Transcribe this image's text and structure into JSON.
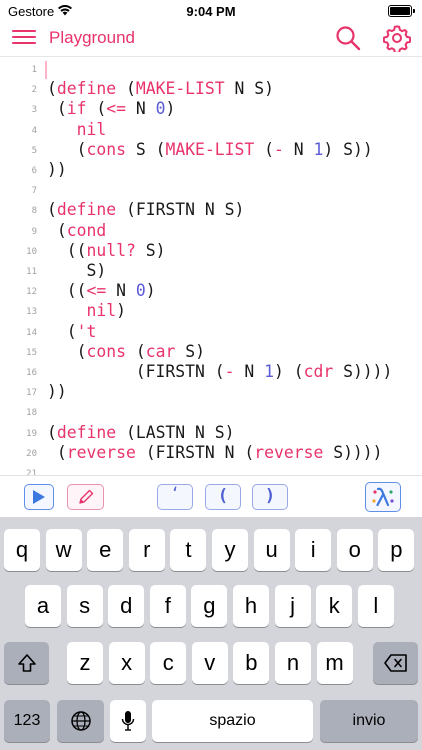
{
  "status_bar": {
    "carrier": "Gestore",
    "time": "9:04 PM"
  },
  "nav": {
    "title": "Playground",
    "menu_icon": "hamburger-menu-icon",
    "search_icon": "search-icon",
    "settings_icon": "gear-icon"
  },
  "editor": {
    "lines": [
      {
        "n": "1",
        "tokens": []
      },
      {
        "n": "2",
        "tokens": [
          {
            "t": "("
          },
          {
            "t": "define",
            "k": "kw"
          },
          {
            "t": " ("
          },
          {
            "t": "MAKE-LIST",
            "k": "kw"
          },
          {
            "t": " N S)"
          }
        ]
      },
      {
        "n": "3",
        "tokens": [
          {
            "t": " ("
          },
          {
            "t": "if",
            "k": "kw"
          },
          {
            "t": " ("
          },
          {
            "t": "<=",
            "k": "kw"
          },
          {
            "t": " N "
          },
          {
            "t": "0",
            "k": "num"
          },
          {
            "t": ")"
          }
        ]
      },
      {
        "n": "4",
        "tokens": [
          {
            "t": "   "
          },
          {
            "t": "nil",
            "k": "kw"
          }
        ]
      },
      {
        "n": "5",
        "tokens": [
          {
            "t": "   ("
          },
          {
            "t": "cons",
            "k": "kw"
          },
          {
            "t": " S ("
          },
          {
            "t": "MAKE-LIST",
            "k": "kw"
          },
          {
            "t": " ("
          },
          {
            "t": "-",
            "k": "kw"
          },
          {
            "t": " N "
          },
          {
            "t": "1",
            "k": "num"
          },
          {
            "t": ") S))"
          }
        ]
      },
      {
        "n": "6",
        "tokens": [
          {
            "t": "))"
          }
        ]
      },
      {
        "n": "7",
        "tokens": []
      },
      {
        "n": "8",
        "tokens": [
          {
            "t": "("
          },
          {
            "t": "define",
            "k": "kw"
          },
          {
            "t": " (FIRSTN N S)"
          }
        ]
      },
      {
        "n": "9",
        "tokens": [
          {
            "t": " ("
          },
          {
            "t": "cond",
            "k": "kw"
          }
        ]
      },
      {
        "n": "10",
        "tokens": [
          {
            "t": "  (("
          },
          {
            "t": "null?",
            "k": "kw"
          },
          {
            "t": " S)"
          }
        ]
      },
      {
        "n": "11",
        "tokens": [
          {
            "t": "    S)"
          }
        ]
      },
      {
        "n": "12",
        "tokens": [
          {
            "t": "  (("
          },
          {
            "t": "<=",
            "k": "kw"
          },
          {
            "t": " N "
          },
          {
            "t": "0",
            "k": "num"
          },
          {
            "t": ")"
          }
        ]
      },
      {
        "n": "13",
        "tokens": [
          {
            "t": "    "
          },
          {
            "t": "nil",
            "k": "kw"
          },
          {
            "t": ")"
          }
        ]
      },
      {
        "n": "14",
        "tokens": [
          {
            "t": "  ("
          },
          {
            "t": "'t",
            "k": "kw"
          }
        ]
      },
      {
        "n": "15",
        "tokens": [
          {
            "t": "   ("
          },
          {
            "t": "cons",
            "k": "kw"
          },
          {
            "t": " ("
          },
          {
            "t": "car",
            "k": "kw"
          },
          {
            "t": " S)"
          }
        ]
      },
      {
        "n": "16",
        "tokens": [
          {
            "t": "         (FIRSTN ("
          },
          {
            "t": "-",
            "k": "kw"
          },
          {
            "t": " N "
          },
          {
            "t": "1",
            "k": "num"
          },
          {
            "t": ") ("
          },
          {
            "t": "cdr",
            "k": "kw"
          },
          {
            "t": " S))))"
          }
        ]
      },
      {
        "n": "17",
        "tokens": [
          {
            "t": "))"
          }
        ]
      },
      {
        "n": "18",
        "tokens": []
      },
      {
        "n": "19",
        "tokens": [
          {
            "t": "("
          },
          {
            "t": "define",
            "k": "kw"
          },
          {
            "t": " (LASTN N S)"
          }
        ]
      },
      {
        "n": "20",
        "tokens": [
          {
            "t": " ("
          },
          {
            "t": "reverse",
            "k": "kw"
          },
          {
            "t": " (FIRSTN N ("
          },
          {
            "t": "reverse",
            "k": "kw"
          },
          {
            "t": " S))))"
          }
        ]
      },
      {
        "n": "21",
        "tokens": []
      }
    ]
  },
  "toolbar": {
    "run_icon": "play-icon",
    "edit_icon": "pencil-icon",
    "quote_label": "‘",
    "lparen_label": "(",
    "rparen_label": ")",
    "lambda_icon": "lambda-icon"
  },
  "keyboard": {
    "row1": [
      "q",
      "w",
      "e",
      "r",
      "t",
      "y",
      "u",
      "i",
      "o",
      "p"
    ],
    "row2": [
      "a",
      "s",
      "d",
      "f",
      "g",
      "h",
      "j",
      "k",
      "l"
    ],
    "row3": [
      "z",
      "x",
      "c",
      "v",
      "b",
      "n",
      "m"
    ],
    "numbers_label": "123",
    "space_label": "spazio",
    "return_label": "invio",
    "shift_icon": "shift-icon",
    "backspace_icon": "backspace-icon",
    "globe_icon": "globe-icon",
    "mic_icon": "microphone-icon"
  },
  "colors": {
    "accent": "#e8336b",
    "number": "#5b5bd6",
    "toolbar_blue": "#5f8fe8"
  }
}
